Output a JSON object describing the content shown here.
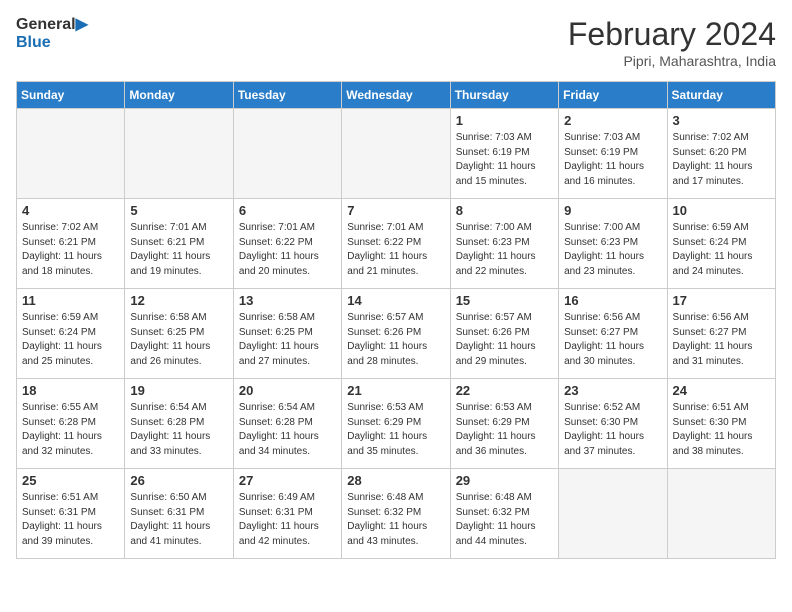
{
  "logo": {
    "line1": "General",
    "line2": "Blue"
  },
  "title": "February 2024",
  "subtitle": "Pipri, Maharashtra, India",
  "headers": [
    "Sunday",
    "Monday",
    "Tuesday",
    "Wednesday",
    "Thursday",
    "Friday",
    "Saturday"
  ],
  "weeks": [
    [
      {
        "day": "",
        "info": "",
        "empty": true
      },
      {
        "day": "",
        "info": "",
        "empty": true
      },
      {
        "day": "",
        "info": "",
        "empty": true
      },
      {
        "day": "",
        "info": "",
        "empty": true
      },
      {
        "day": "1",
        "info": "Sunrise: 7:03 AM\nSunset: 6:19 PM\nDaylight: 11 hours\nand 15 minutes.",
        "empty": false
      },
      {
        "day": "2",
        "info": "Sunrise: 7:03 AM\nSunset: 6:19 PM\nDaylight: 11 hours\nand 16 minutes.",
        "empty": false
      },
      {
        "day": "3",
        "info": "Sunrise: 7:02 AM\nSunset: 6:20 PM\nDaylight: 11 hours\nand 17 minutes.",
        "empty": false
      }
    ],
    [
      {
        "day": "4",
        "info": "Sunrise: 7:02 AM\nSunset: 6:21 PM\nDaylight: 11 hours\nand 18 minutes.",
        "empty": false
      },
      {
        "day": "5",
        "info": "Sunrise: 7:01 AM\nSunset: 6:21 PM\nDaylight: 11 hours\nand 19 minutes.",
        "empty": false
      },
      {
        "day": "6",
        "info": "Sunrise: 7:01 AM\nSunset: 6:22 PM\nDaylight: 11 hours\nand 20 minutes.",
        "empty": false
      },
      {
        "day": "7",
        "info": "Sunrise: 7:01 AM\nSunset: 6:22 PM\nDaylight: 11 hours\nand 21 minutes.",
        "empty": false
      },
      {
        "day": "8",
        "info": "Sunrise: 7:00 AM\nSunset: 6:23 PM\nDaylight: 11 hours\nand 22 minutes.",
        "empty": false
      },
      {
        "day": "9",
        "info": "Sunrise: 7:00 AM\nSunset: 6:23 PM\nDaylight: 11 hours\nand 23 minutes.",
        "empty": false
      },
      {
        "day": "10",
        "info": "Sunrise: 6:59 AM\nSunset: 6:24 PM\nDaylight: 11 hours\nand 24 minutes.",
        "empty": false
      }
    ],
    [
      {
        "day": "11",
        "info": "Sunrise: 6:59 AM\nSunset: 6:24 PM\nDaylight: 11 hours\nand 25 minutes.",
        "empty": false
      },
      {
        "day": "12",
        "info": "Sunrise: 6:58 AM\nSunset: 6:25 PM\nDaylight: 11 hours\nand 26 minutes.",
        "empty": false
      },
      {
        "day": "13",
        "info": "Sunrise: 6:58 AM\nSunset: 6:25 PM\nDaylight: 11 hours\nand 27 minutes.",
        "empty": false
      },
      {
        "day": "14",
        "info": "Sunrise: 6:57 AM\nSunset: 6:26 PM\nDaylight: 11 hours\nand 28 minutes.",
        "empty": false
      },
      {
        "day": "15",
        "info": "Sunrise: 6:57 AM\nSunset: 6:26 PM\nDaylight: 11 hours\nand 29 minutes.",
        "empty": false
      },
      {
        "day": "16",
        "info": "Sunrise: 6:56 AM\nSunset: 6:27 PM\nDaylight: 11 hours\nand 30 minutes.",
        "empty": false
      },
      {
        "day": "17",
        "info": "Sunrise: 6:56 AM\nSunset: 6:27 PM\nDaylight: 11 hours\nand 31 minutes.",
        "empty": false
      }
    ],
    [
      {
        "day": "18",
        "info": "Sunrise: 6:55 AM\nSunset: 6:28 PM\nDaylight: 11 hours\nand 32 minutes.",
        "empty": false
      },
      {
        "day": "19",
        "info": "Sunrise: 6:54 AM\nSunset: 6:28 PM\nDaylight: 11 hours\nand 33 minutes.",
        "empty": false
      },
      {
        "day": "20",
        "info": "Sunrise: 6:54 AM\nSunset: 6:28 PM\nDaylight: 11 hours\nand 34 minutes.",
        "empty": false
      },
      {
        "day": "21",
        "info": "Sunrise: 6:53 AM\nSunset: 6:29 PM\nDaylight: 11 hours\nand 35 minutes.",
        "empty": false
      },
      {
        "day": "22",
        "info": "Sunrise: 6:53 AM\nSunset: 6:29 PM\nDaylight: 11 hours\nand 36 minutes.",
        "empty": false
      },
      {
        "day": "23",
        "info": "Sunrise: 6:52 AM\nSunset: 6:30 PM\nDaylight: 11 hours\nand 37 minutes.",
        "empty": false
      },
      {
        "day": "24",
        "info": "Sunrise: 6:51 AM\nSunset: 6:30 PM\nDaylight: 11 hours\nand 38 minutes.",
        "empty": false
      }
    ],
    [
      {
        "day": "25",
        "info": "Sunrise: 6:51 AM\nSunset: 6:31 PM\nDaylight: 11 hours\nand 39 minutes.",
        "empty": false
      },
      {
        "day": "26",
        "info": "Sunrise: 6:50 AM\nSunset: 6:31 PM\nDaylight: 11 hours\nand 41 minutes.",
        "empty": false
      },
      {
        "day": "27",
        "info": "Sunrise: 6:49 AM\nSunset: 6:31 PM\nDaylight: 11 hours\nand 42 minutes.",
        "empty": false
      },
      {
        "day": "28",
        "info": "Sunrise: 6:48 AM\nSunset: 6:32 PM\nDaylight: 11 hours\nand 43 minutes.",
        "empty": false
      },
      {
        "day": "29",
        "info": "Sunrise: 6:48 AM\nSunset: 6:32 PM\nDaylight: 11 hours\nand 44 minutes.",
        "empty": false
      },
      {
        "day": "",
        "info": "",
        "empty": true
      },
      {
        "day": "",
        "info": "",
        "empty": true
      }
    ]
  ]
}
